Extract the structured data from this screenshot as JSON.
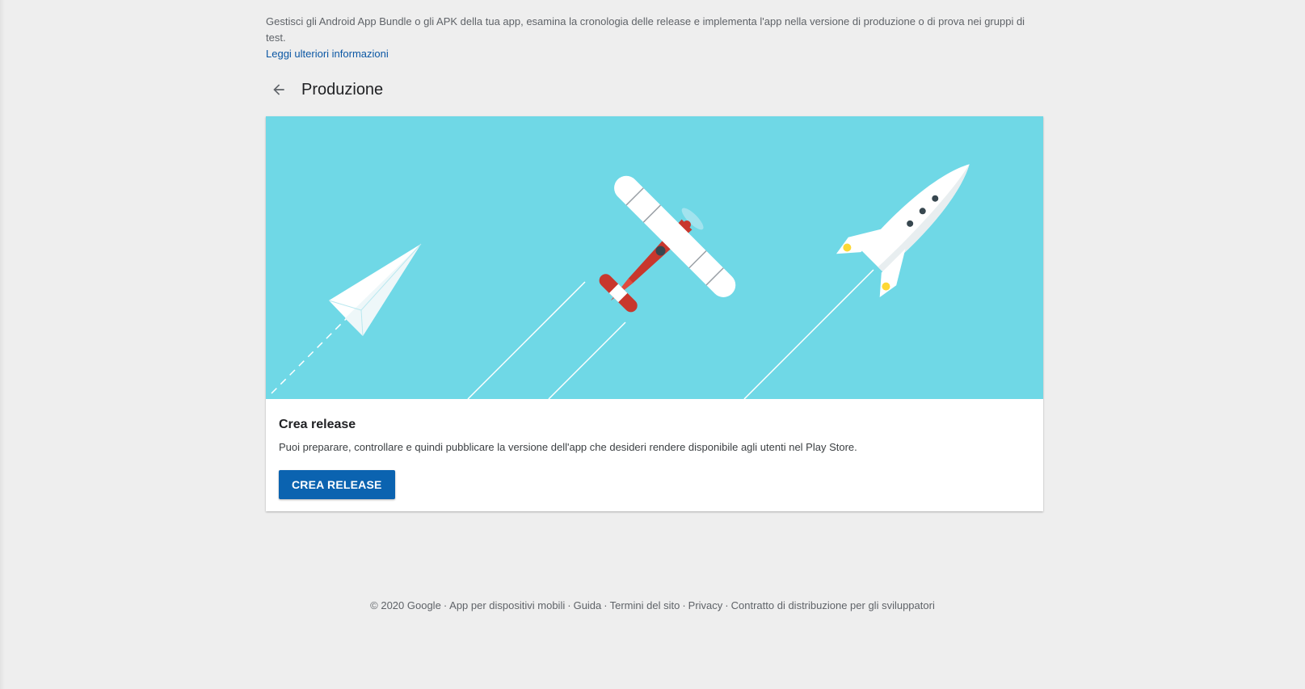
{
  "intro": {
    "text": "Gestisci gli Android App Bundle o gli APK della tua app, esamina la cronologia delle release e implementa l'app nella versione di produzione o di prova nei gruppi di test.",
    "learn_more": "Leggi ulteriori informazioni"
  },
  "header": {
    "back_icon": "arrow-back-icon",
    "title": "Produzione"
  },
  "card": {
    "illustration": "paper-plane-airplane-rocket-illustration",
    "illustration_bg": "#6fd8e6",
    "title": "Crea release",
    "description": "Puoi preparare, controllare e quindi pubblicare la versione dell'app che desideri rendere disponibile agli utenti nel Play Store.",
    "button_label": "CREA RELEASE",
    "button_color": "#0b63b0"
  },
  "footer": {
    "copyright": "© 2020 Google",
    "links": [
      "App per dispositivi mobili",
      "Guida",
      "Termini del sito",
      "Privacy",
      "Contratto di distribuzione per gli sviluppatori"
    ],
    "separator": "·"
  }
}
